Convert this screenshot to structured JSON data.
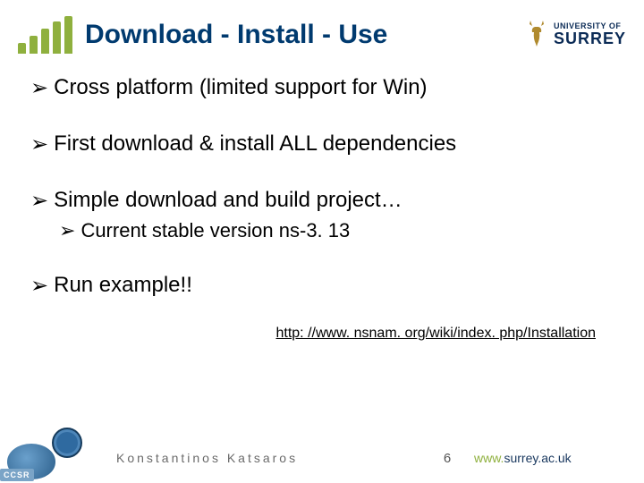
{
  "header": {
    "title": "Download - Install - Use",
    "surrey_top": "UNIVERSITY OF",
    "surrey_bottom": "SURREY"
  },
  "bullets": {
    "b1": "Cross platform (limited support for Win)",
    "b2": "First download & install ALL dependencies",
    "b3": "Simple download and build project…",
    "b3a": "Current stable version ns-3. 13",
    "b4": "Run example!!"
  },
  "link": "http: //www. nsnam. org/wiki/index. php/Installation",
  "footer": {
    "ccsr": "CCSR",
    "author": "Konstantinos Katsaros",
    "page": "6",
    "url_prefix": "www.",
    "url_rest": "surrey.ac.uk"
  }
}
